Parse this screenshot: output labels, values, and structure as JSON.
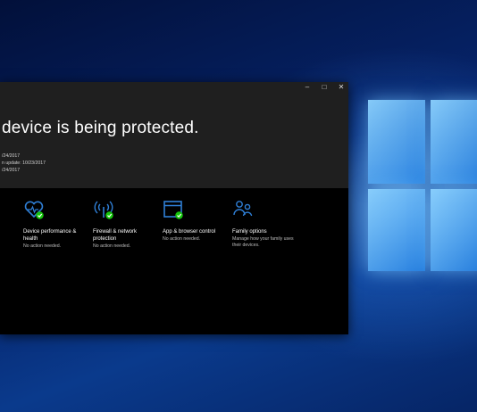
{
  "window": {
    "controls": {
      "minimize": "–",
      "maximize": "□",
      "close": "✕"
    }
  },
  "hero": {
    "title": "device is being protected.",
    "lines": [
      "/24/2017",
      "n update: 10/23/2017",
      "/24/2017"
    ]
  },
  "tiles": [
    {
      "icon": "heart-health-icon",
      "name": "Device performance & health",
      "status": "No action needed."
    },
    {
      "icon": "wifi-antenna-icon",
      "name": "Firewall & network protection",
      "status": "No action needed."
    },
    {
      "icon": "browser-window-icon",
      "name": "App & browser control",
      "status": "No action needed."
    },
    {
      "icon": "family-icon",
      "name": "Family options",
      "status": "Manage how your family uses their devices."
    }
  ],
  "colors": {
    "accent": "#2f7fd6",
    "check": "#16c60c",
    "hero_bg": "#1f1f1f"
  }
}
